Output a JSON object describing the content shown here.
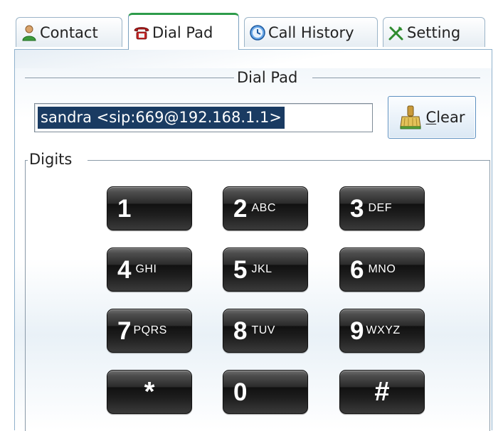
{
  "tabs": [
    {
      "label": "Contact",
      "icon": "contact-icon",
      "active": false
    },
    {
      "label": "Dial Pad",
      "icon": "phone-icon",
      "active": true
    },
    {
      "label": "Call History",
      "icon": "clock-icon",
      "active": false
    },
    {
      "label": "Setting",
      "icon": "tools-icon",
      "active": false
    }
  ],
  "dialpad": {
    "group_title": "Dial Pad",
    "entry_value": "sandra <sip:669@192.168.1.1>",
    "clear_button": {
      "mnemonic": "C",
      "rest": "lear",
      "icon": "broom-icon"
    }
  },
  "digits": {
    "group_title": "Digits",
    "keys": [
      {
        "digit": "1",
        "letters": ""
      },
      {
        "digit": "2",
        "letters": "ABC"
      },
      {
        "digit": "3",
        "letters": "DEF"
      },
      {
        "digit": "4",
        "letters": "GHI"
      },
      {
        "digit": "5",
        "letters": "JKL"
      },
      {
        "digit": "6",
        "letters": "MNO"
      },
      {
        "digit": "7",
        "letters": "PQRS"
      },
      {
        "digit": "8",
        "letters": "TUV"
      },
      {
        "digit": "9",
        "letters": "WXYZ"
      },
      {
        "digit": "*",
        "letters": ""
      },
      {
        "digit": "0",
        "letters": ""
      },
      {
        "digit": "#",
        "letters": ""
      }
    ]
  },
  "colors": {
    "selection": "#1a3b62",
    "active_tab_accent": "#2d9b4a",
    "key_face": "#1e1e1e"
  }
}
